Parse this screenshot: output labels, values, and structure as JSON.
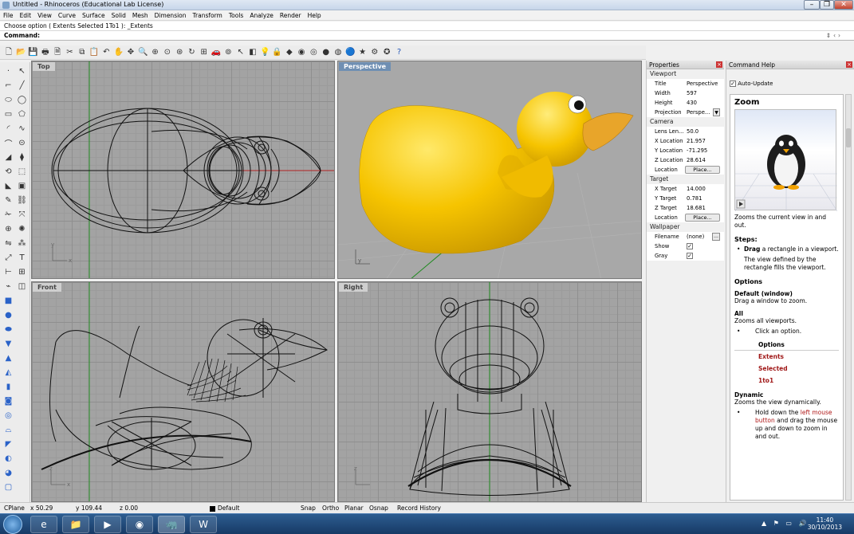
{
  "window": {
    "title": "Untitled - Rhinoceros (Educational Lab License)"
  },
  "menu": [
    "File",
    "Edit",
    "View",
    "Curve",
    "Surface",
    "Solid",
    "Mesh",
    "Dimension",
    "Transform",
    "Tools",
    "Analyze",
    "Render",
    "Help"
  ],
  "command_history": "Choose option ( Extents  Selected  1To1 ): _Extents",
  "command_prompt": "Command:",
  "viewports": {
    "top": "Top",
    "perspective": "Perspective",
    "front": "Front",
    "right": "Right"
  },
  "properties": {
    "header": "Properties",
    "viewport_section": "Viewport",
    "viewport_rows": [
      {
        "key": "Title",
        "value": "Perspective"
      },
      {
        "key": "Width",
        "value": "597"
      },
      {
        "key": "Height",
        "value": "430"
      },
      {
        "key": "Projection",
        "value": "Perspe..."
      }
    ],
    "camera_section": "Camera",
    "camera_rows": [
      {
        "key": "Lens Len...",
        "value": "50.0"
      },
      {
        "key": "X Location",
        "value": "21.957"
      },
      {
        "key": "Y Location",
        "value": "-71.295"
      },
      {
        "key": "Z Location",
        "value": "28.614"
      }
    ],
    "camera_location_label": "Location",
    "place_label": "Place...",
    "target_section": "Target",
    "target_rows": [
      {
        "key": "X Target",
        "value": "14.000"
      },
      {
        "key": "Y Target",
        "value": "0.781"
      },
      {
        "key": "Z Target",
        "value": "18.681"
      }
    ],
    "target_location_label": "Location",
    "wallpaper_section": "Wallpaper",
    "filename_label": "Filename",
    "filename_value": "(none)",
    "show_label": "Show",
    "gray_label": "Gray"
  },
  "help": {
    "header": "Command Help",
    "auto_update": "Auto-Update",
    "title": "Zoom",
    "intro": "Zooms the current view in and out.",
    "steps_heading": "Steps:",
    "step_drag_bold": "Drag",
    "step_drag_rest": " a rectangle in a viewport.",
    "step_result": "The view defined by the rectangle fills the viewport.",
    "options_heading": "Options",
    "default_heading": "Default (window)",
    "default_text": "Drag a window to zoom.",
    "all_heading": "All",
    "all_text": "Zooms all viewports.",
    "click_option": "Click an option.",
    "options_sub": "Options",
    "option_list": [
      "Extents",
      "Selected",
      "1to1"
    ],
    "dynamic_heading": "Dynamic",
    "dynamic_text": "Zooms the view dynamically.",
    "dynamic_step_a": "Hold down the ",
    "dynamic_step_red": "left mouse button",
    "dynamic_step_b": " and drag the mouse up and down to zoom in and out."
  },
  "status": {
    "cplane": "CPlane",
    "x": "x 50.29",
    "y": "y 109.44",
    "z": "z 0.00",
    "layer": "Default",
    "snap": "Snap",
    "ortho": "Ortho",
    "planar": "Planar",
    "osnap": "Osnap",
    "record": "Record History"
  },
  "clock": {
    "time": "11:40",
    "date": "30/10/2013"
  },
  "colors": {
    "duck": "#f6c400",
    "beak": "#e8a52a",
    "active_label": "#6f8fb3",
    "x_axis": "#b02020",
    "y_axis": "#1f8a1f"
  }
}
